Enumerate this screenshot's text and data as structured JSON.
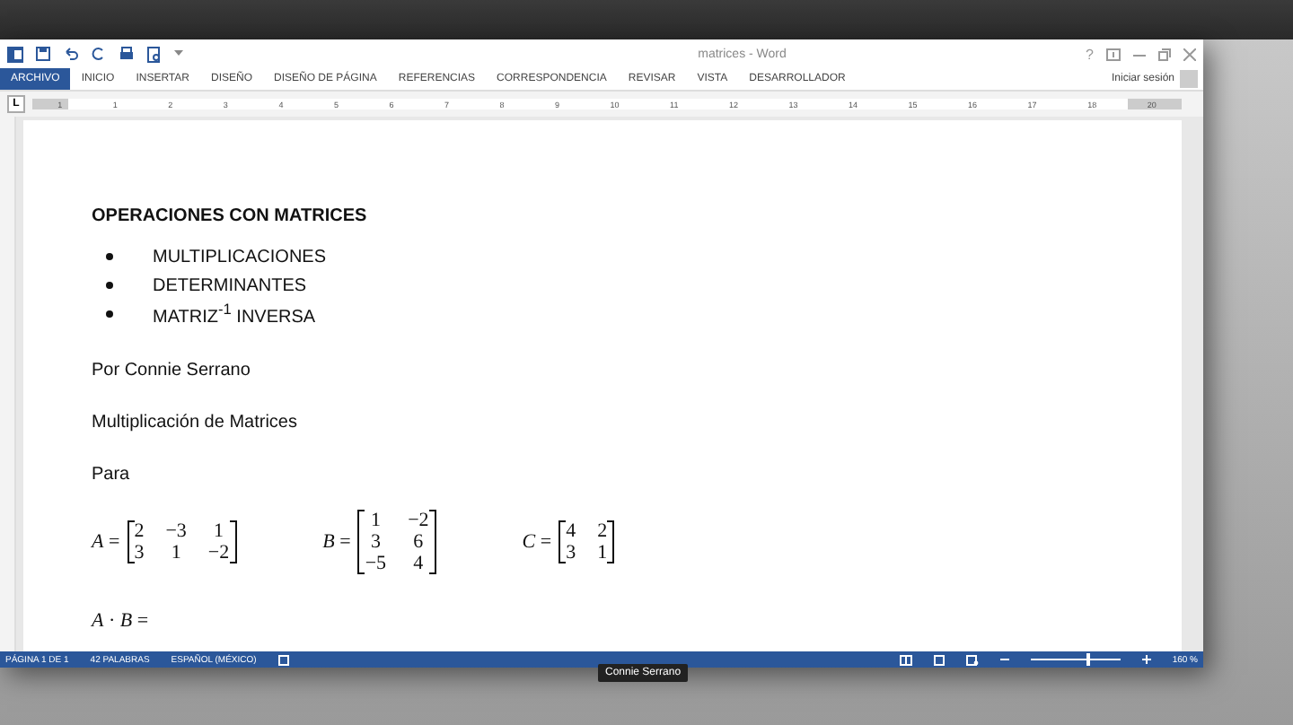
{
  "window": {
    "title": "matrices - Word",
    "controls": [
      "?"
    ]
  },
  "ribbon_tabs": [
    {
      "label": "ARCHIVO",
      "selected": true
    },
    {
      "label": "INICIO",
      "selected": false
    },
    {
      "label": "INSERTAR",
      "selected": false
    },
    {
      "label": "DISEÑO",
      "selected": false
    },
    {
      "label": "DISEÑO DE PÁGINA",
      "selected": false
    },
    {
      "label": "REFERENCIAS",
      "selected": false
    },
    {
      "label": "CORRESPONDENCIA",
      "selected": false
    },
    {
      "label": "REVISAR",
      "selected": false
    },
    {
      "label": "VISTA",
      "selected": false
    },
    {
      "label": "DESARROLLADOR",
      "selected": false
    }
  ],
  "sign_in": "Iniciar sesión",
  "ruler": {
    "tab_marker": "L",
    "numbers": [
      "1",
      "1",
      "2",
      "3",
      "4",
      "5",
      "6",
      "7",
      "8",
      "9",
      "10",
      "11",
      "12",
      "13",
      "14",
      "15",
      "16",
      "17",
      "18",
      "20"
    ]
  },
  "document": {
    "heading": "OPERACIONES CON MATRICES",
    "bullets": [
      "MULTIPLICACIONES",
      "DETERMINANTES",
      "MATRIZ$^{-1}$ INVERSA"
    ],
    "paragraphs": [
      "Por Connie Serrano",
      "Multiplicación de Matrices",
      "Para"
    ],
    "matrices": [
      {
        "label": "*A* =",
        "rows": [
          [
            "2",
            "−3",
            "1"
          ],
          [
            "3",
            "1",
            "−2"
          ]
        ]
      },
      {
        "label": "*B* =",
        "rows": [
          [
            "1",
            "−2"
          ],
          [
            "3",
            "6"
          ],
          [
            "−5",
            "4"
          ]
        ]
      },
      {
        "label": "*C* =",
        "rows": [
          [
            "4",
            "2"
          ],
          [
            "3",
            "1"
          ]
        ]
      }
    ],
    "product": "*A* · *B* ="
  },
  "status_bar": {
    "items": [
      "PÁGINA 1 DE 1",
      "42 PALABRAS",
      "ESPAÑOL (MÉXICO)"
    ],
    "zoom": {
      "level": 0.62,
      "reading": "160 %"
    }
  },
  "name_tag": "Connie Serrano"
}
